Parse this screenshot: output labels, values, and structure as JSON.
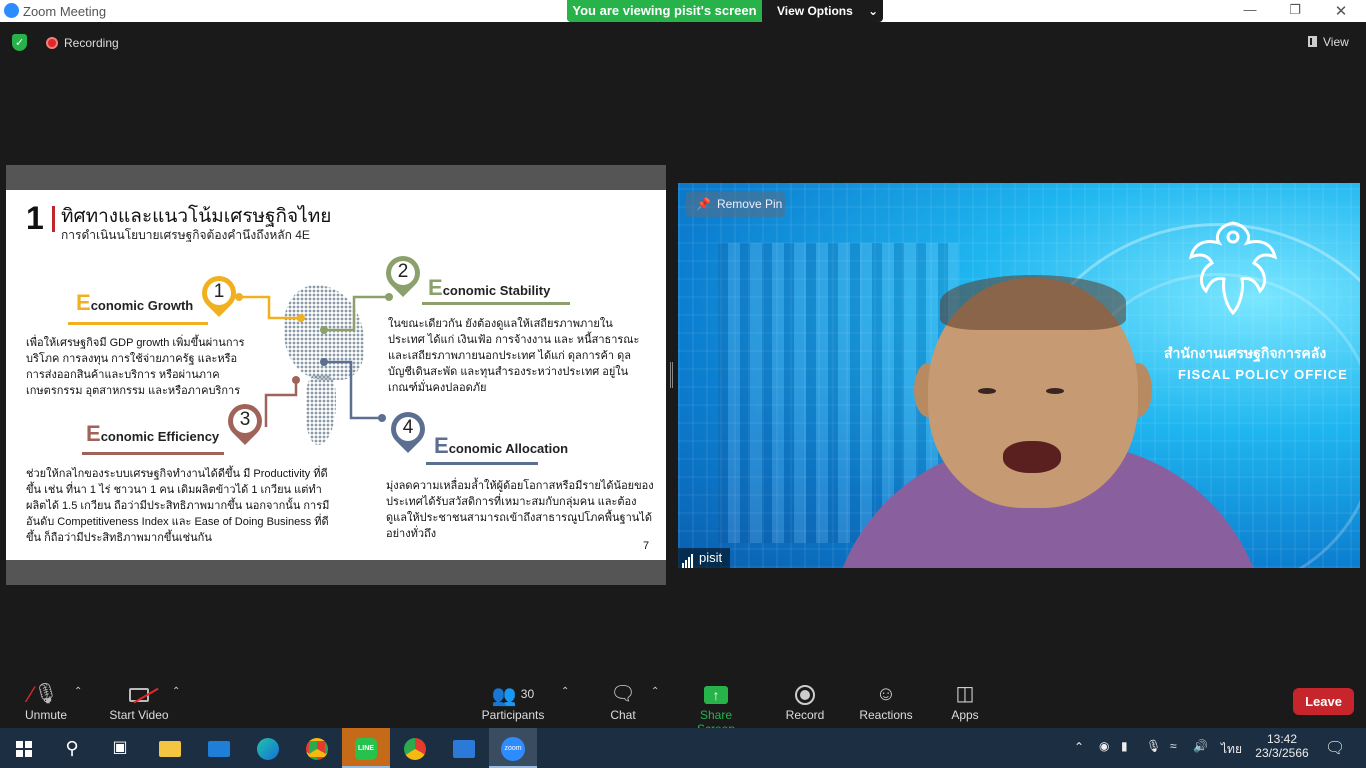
{
  "window": {
    "title": "Zoom Meeting",
    "banner_text": "You are viewing pisit's screen",
    "view_options_label": "View Options"
  },
  "meeting_bar": {
    "recording_label": "Recording",
    "view_label": "View"
  },
  "slide": {
    "number": "1",
    "title": "ทิศทางและแนวโน้มเศรษฐกิจไทย",
    "subtitle": "การดำเนินนโยบายเศรษฐกิจต้องคำนึงถึงหลัก 4E",
    "page": "7",
    "sections": [
      {
        "pin": "1",
        "title_initial": "E",
        "title_rest": "conomic Growth",
        "text": "เพื่อให้เศรษฐกิจมี GDP growth เพิ่มขึ้นผ่านการบริโภค การลงทุน การใช้จ่ายภาครัฐ และหรือการส่งออกสินค้าและบริการ หรือผ่านภาคเกษตรกรรม อุตสาหกรรม และหรือภาคบริการ"
      },
      {
        "pin": "2",
        "title_initial": "E",
        "title_rest": "conomic Stability",
        "text": "ในขณะเดียวกัน ยังต้องดูแลให้เสถียรภาพภายในประเทศ ได้แก่ เงินเฟ้อ การจ้างงาน และ หนี้สาธารณะ และเสถียรภาพภายนอกประเทศ ได้แก่ ดุลการค้า ดุลบัญชีเดินสะพัด และทุนสำรองระหว่างประเทศ อยู่ในเกณฑ์มั่นคงปลอดภัย"
      },
      {
        "pin": "3",
        "title_initial": "E",
        "title_rest": "conomic Efficiency",
        "text": "ช่วยให้กลไกของระบบเศรษฐกิจทำงานได้ดีขึ้น มี Productivity ที่ดีขึ้น เช่น ที่นา 1 ไร่ ชาวนา 1 คน เดิมผลิตข้าวได้ 1 เกวียน แต่ทำผลิตได้ 1.5 เกวียน ถือว่ามีประสิทธิภาพมากขึ้น นอกจากนั้น การมีอันดับ Competitiveness Index และ Ease of Doing Business ที่ดีขึ้น ก็ถือว่ามีประสิทธิภาพมากขึ้นเช่นกัน"
      },
      {
        "pin": "4",
        "title_initial": "E",
        "title_rest": "conomic Allocation",
        "text": "มุ่งลดความเหลื่อมล้ำให้ผู้ด้อยโอกาสหรือมีรายได้น้อยของประเทศได้รับสวัสดิการที่เหมาะสมกับกลุ่มคน และต้องดูแลให้ประชาชนสามารถเข้าถึงสาธารณูปโภคพื้นฐานได้อย่างทั่วถึง"
      }
    ]
  },
  "video": {
    "remove_pin_label": "Remove Pin",
    "org_th": "สำนักงานเศรษฐกิจการคลัง",
    "org_en": "FISCAL POLICY OFFICE",
    "participant_name": "pisit"
  },
  "toolbar": {
    "unmute": "Unmute",
    "start_video": "Start Video",
    "participants": "Participants",
    "participants_count": "30",
    "chat": "Chat",
    "share_screen": "Share Screen",
    "record": "Record",
    "reactions": "Reactions",
    "apps": "Apps",
    "leave": "Leave"
  },
  "taskbar": {
    "lang": "ไทย",
    "time": "13:42",
    "date": "23/3/2566",
    "line_label": "LINE",
    "zoom_label": "zoom"
  },
  "colors": {
    "zoom_blue": "#2d8cff",
    "banner_green": "#27b34a",
    "leave_red": "#c6262b",
    "growth": "#f0b020",
    "stability": "#8ba06a",
    "efficiency": "#a0635a",
    "allocation": "#5c6f90"
  }
}
